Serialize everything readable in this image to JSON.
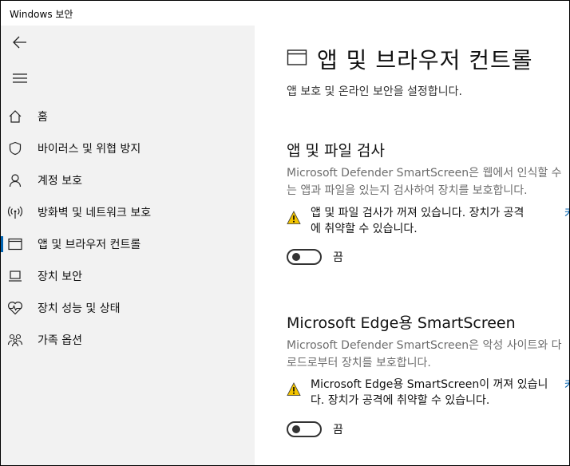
{
  "window": {
    "title": "Windows 보안"
  },
  "sidebar": {
    "items": [
      {
        "label": "홈",
        "icon": "home-icon"
      },
      {
        "label": "바이러스 및 위협 방지",
        "icon": "shield-icon"
      },
      {
        "label": "계정 보호",
        "icon": "person-icon"
      },
      {
        "label": "방화벽 및 네트워크 보호",
        "icon": "wireless-icon"
      },
      {
        "label": "앱 및 브라우저 컨트롤",
        "icon": "app-window-icon",
        "selected": true
      },
      {
        "label": "장치 보안",
        "icon": "laptop-icon"
      },
      {
        "label": "장치 성능 및 상태",
        "icon": "heart-pulse-icon"
      },
      {
        "label": "가족 옵션",
        "icon": "family-icon"
      }
    ]
  },
  "main": {
    "title": "앱 및 브라우저 컨트롤",
    "subtitle": "앱 보호 및 온라인 보안을 설정합니다.",
    "sections": [
      {
        "title": "앱 및 파일 검사",
        "desc_line1": "Microsoft Defender SmartScreen은 웹에서 인식할 수",
        "desc_line2": "는 앱과 파일을 있는지 검사하여 장치를 보호합니다.",
        "warning_line1": "앱 및 파일 검사가 꺼져 있습니다. 장치가 공격",
        "warning_line2": "에 취약할 수 있습니다.",
        "warning_link": "켜",
        "toggle_label": "끔"
      },
      {
        "title": "Microsoft Edge용 SmartScreen",
        "desc_line1": "Microsoft Defender SmartScreen은 악성 사이트와 다",
        "desc_line2": "로드로부터 장치를 보호합니다.",
        "warning_line1": "Microsoft Edge용 SmartScreen이 꺼져 있습니",
        "warning_line2": "다. 장치가 공격에 취약할 수 있습니다.",
        "warning_link": "켜",
        "toggle_label": "끔"
      }
    ]
  },
  "colors": {
    "accent": "#0063b1",
    "warning": "#f3c400",
    "sidebar_bg": "#f2f2f2"
  }
}
